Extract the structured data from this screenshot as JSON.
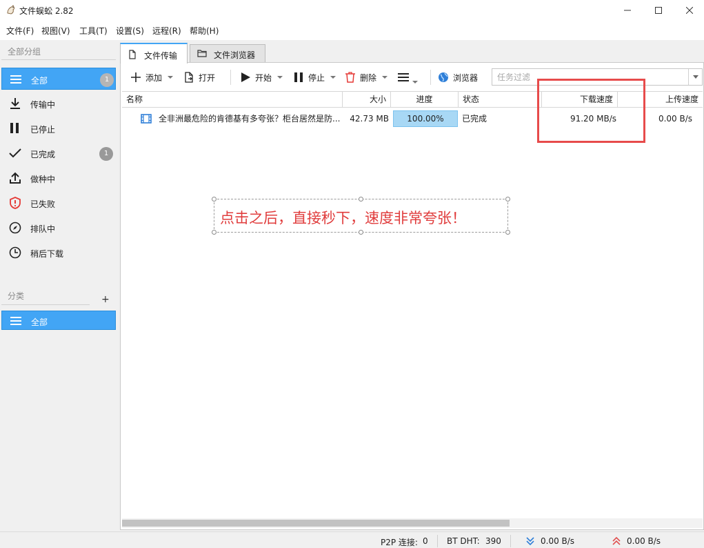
{
  "window": {
    "title": "文件蜈蚣 2.82",
    "menu": [
      "文件(F)",
      "视图(V)",
      "工具(T)",
      "设置(S)",
      "远程(R)",
      "帮助(H)"
    ]
  },
  "sidebar": {
    "group_title": "全部分组",
    "items": [
      {
        "label": "全部",
        "badge": "1",
        "icon": "list-icon"
      },
      {
        "label": "传输中",
        "icon": "download-icon"
      },
      {
        "label": "已停止",
        "icon": "pause-icon"
      },
      {
        "label": "已完成",
        "badge": "1",
        "icon": "check-icon"
      },
      {
        "label": "做种中",
        "icon": "upload-icon"
      },
      {
        "label": "已失败",
        "icon": "shield-alert-icon"
      },
      {
        "label": "排队中",
        "icon": "compass-icon"
      },
      {
        "label": "稍后下载",
        "icon": "clock-icon"
      }
    ],
    "category_title": "分类",
    "add_category": "+",
    "category_items": [
      {
        "label": "全部",
        "icon": "list-icon"
      }
    ]
  },
  "tabs": [
    {
      "label": "文件传输",
      "icon": "document-icon"
    },
    {
      "label": "文件浏览器",
      "icon": "folder-icon"
    }
  ],
  "toolbar": {
    "add": "添加",
    "open": "打开",
    "start": "开始",
    "stop": "停止",
    "delete": "删除",
    "browser": "浏览器",
    "filter_placeholder": "任务过滤"
  },
  "table": {
    "headers": {
      "name": "名称",
      "size": "大小",
      "progress": "进度",
      "status": "状态",
      "download_speed": "下载速度",
      "upload_speed": "上传速度"
    },
    "rows": [
      {
        "name": "全非洲最危险的肯德基有多夸张？柜台居然是防...",
        "size": "42.73 MB",
        "progress": "100.00%",
        "progress_fraction": 1.0,
        "status": "已完成",
        "download_speed": "91.20 MB/s",
        "upload_speed": "0.00 B/s"
      }
    ]
  },
  "annotation": {
    "text": "点击之后，直接秒下，速度非常夸张！",
    "color": "#e03c3c"
  },
  "statusbar": {
    "p2p_label": "P2P 连接:",
    "p2p_value": "0",
    "dht_label": "BT DHT:",
    "dht_value": "390",
    "down_speed": "0.00 B/s",
    "up_speed": "0.00 B/s"
  },
  "colors": {
    "accent": "#42a5f5",
    "highlight_box": "#e74b4b",
    "progress_fill": "#a8d8f5",
    "delete_icon": "#e53935",
    "down_arrow": "#2f7fd8",
    "up_arrow": "#e05050"
  }
}
